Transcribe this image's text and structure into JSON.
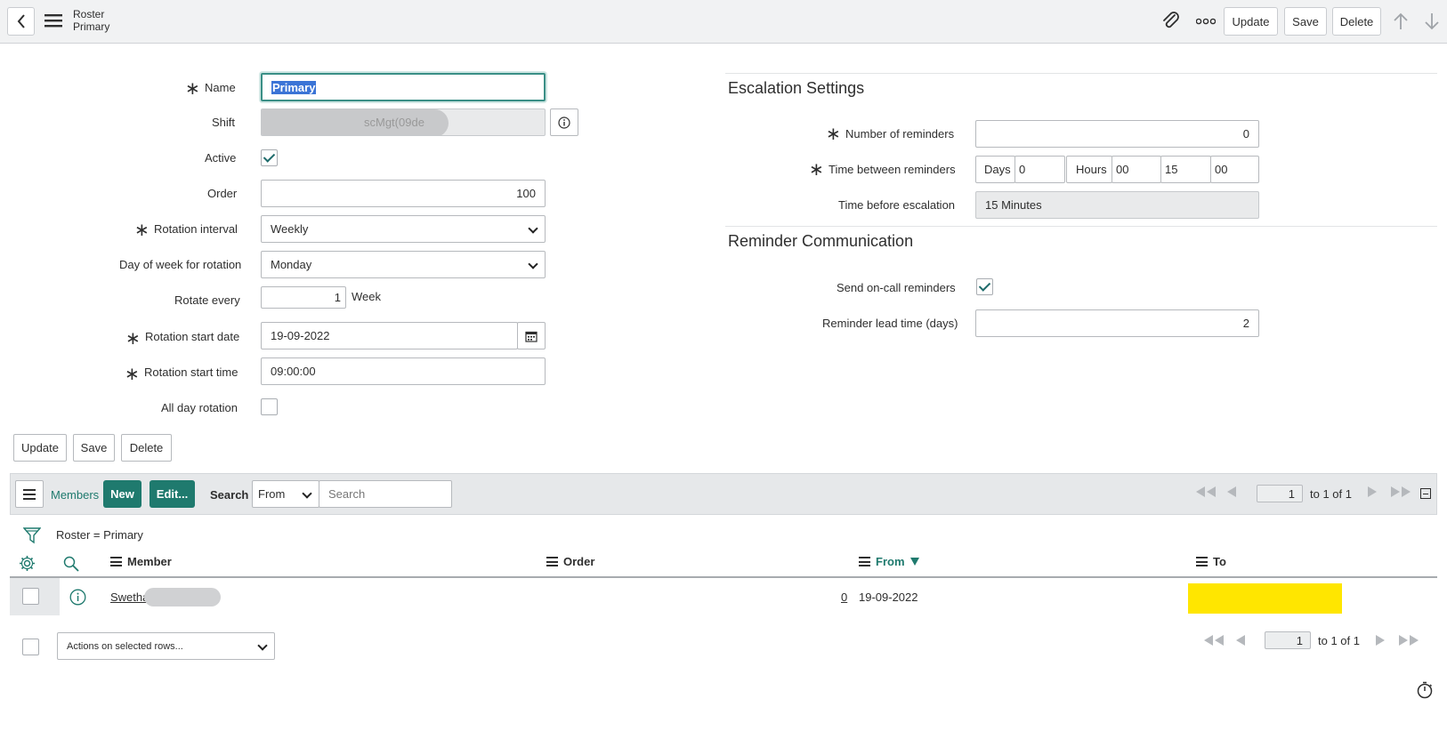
{
  "header": {
    "title": "Roster",
    "subtitle": "Primary",
    "buttons": {
      "update": "Update",
      "save": "Save",
      "delete": "Delete"
    }
  },
  "form": {
    "name": {
      "label": "Name",
      "value": "Primary"
    },
    "shift": {
      "label": "Shift",
      "value": "scMgt(09de"
    },
    "active": {
      "label": "Active",
      "checked": true
    },
    "order": {
      "label": "Order",
      "value": "100"
    },
    "rotation_interval": {
      "label": "Rotation interval",
      "value": "Weekly"
    },
    "day_of_week": {
      "label": "Day of week for rotation",
      "value": "Monday"
    },
    "rotate_every": {
      "label": "Rotate every",
      "value": "1",
      "unit": "Week"
    },
    "rotation_start_date": {
      "label": "Rotation start date",
      "value": "19-09-2022"
    },
    "rotation_start_time": {
      "label": "Rotation start time",
      "value": "09:00:00"
    },
    "all_day_rotation": {
      "label": "All day rotation",
      "checked": false
    }
  },
  "escalation": {
    "title": "Escalation Settings",
    "num_reminders": {
      "label": "Number of reminders",
      "value": "0"
    },
    "time_between": {
      "label": "Time between reminders",
      "days_label": "Days",
      "days": "0",
      "hours_label": "Hours",
      "hours": "00",
      "minutes": "15",
      "seconds": "00"
    },
    "time_before": {
      "label": "Time before escalation",
      "value": "15 Minutes"
    }
  },
  "reminder": {
    "title": "Reminder Communication",
    "send_reminders": {
      "label": "Send on-call reminders",
      "checked": true
    },
    "lead_time": {
      "label": "Reminder lead time (days)",
      "value": "2"
    }
  },
  "bottom_buttons": {
    "update": "Update",
    "save": "Save",
    "delete": "Delete"
  },
  "members": {
    "tab_label": "Members",
    "new_label": "New",
    "edit_label": "Edit...",
    "search_label": "Search",
    "search_field": "From",
    "search_placeholder": "Search",
    "page": "1",
    "page_of": "to 1 of 1",
    "filter": "Roster = Primary",
    "columns": {
      "member": "Member",
      "order": "Order",
      "from": "From",
      "to": "To"
    },
    "rows": [
      {
        "member": "Swetha",
        "order": "0",
        "from": "19-09-2022",
        "to": ""
      }
    ],
    "actions_placeholder": "Actions on selected rows...",
    "footer_page": "1",
    "footer_page_of": "to 1 of 1"
  },
  "colors": {
    "teal": "#1f7a6e",
    "highlight": "#ffe600"
  }
}
